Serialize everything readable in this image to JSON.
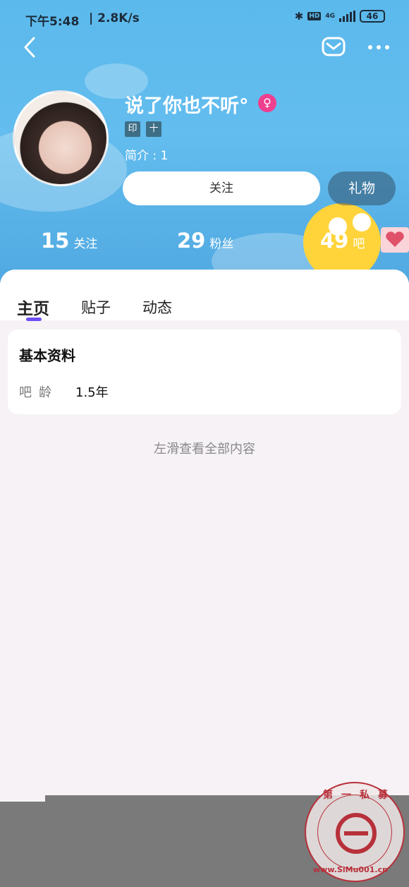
{
  "status_bar": {
    "time": "下午5:48",
    "speed": "| 2.8K/s",
    "network": "4G",
    "hd": "HD",
    "battery": "46"
  },
  "nav": {
    "back_icon": "chevron-left",
    "mail_icon": "mail",
    "more_icon": "more-horizontal"
  },
  "profile": {
    "username": "说了你也不听°",
    "gender_icon": "female",
    "tags": [
      "印",
      "十"
    ],
    "bio": "简介 : 1",
    "follow_button": "关注",
    "gift_button": "礼物"
  },
  "stats": [
    {
      "value": "15",
      "label": "关注"
    },
    {
      "value": "29",
      "label": "粉丝"
    },
    {
      "value": "49",
      "label": "吧"
    }
  ],
  "tabs": [
    "主页",
    "贴子",
    "动态"
  ],
  "basic_info": {
    "title": "基本资料",
    "key": "吧龄",
    "value": "1.5年"
  },
  "hint": "左滑查看全部内容",
  "watermark": {
    "top_text": "第一私募",
    "bottom_text": "www.SiMu001.cn"
  },
  "colors": {
    "header_blue": "#5cb9ec",
    "accent_purple": "#6e4ff5",
    "gender_pink": "#ef3f8f"
  }
}
